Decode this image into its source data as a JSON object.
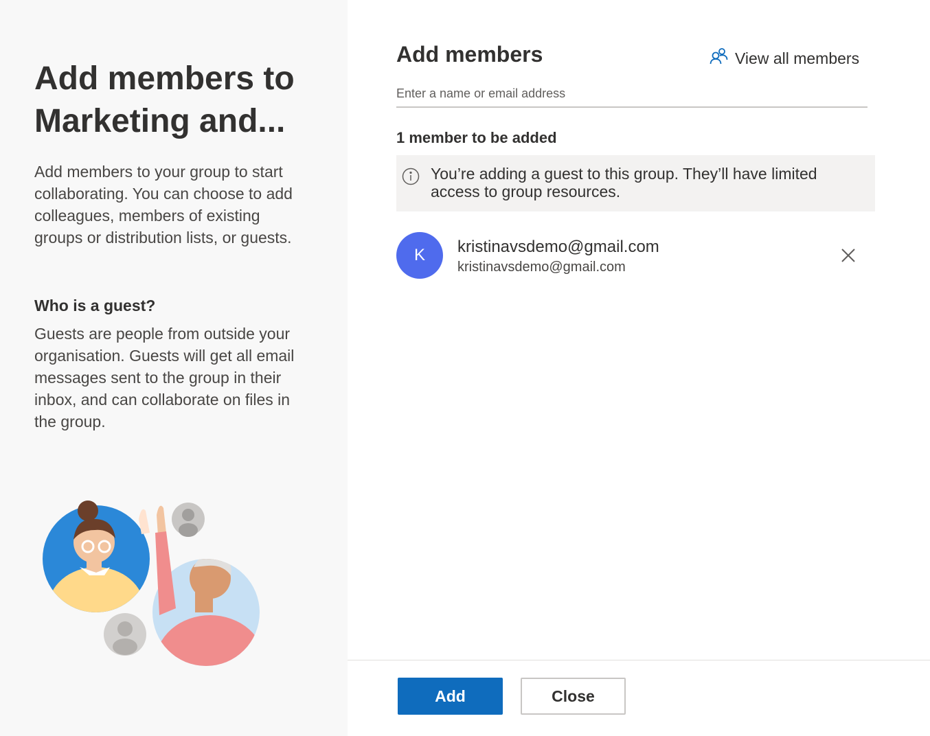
{
  "left": {
    "title": "Add members to Marketing and...",
    "description": "Add members to your group to start collaborating. You can choose to add colleagues, members of existing groups or distribution lists, or guests.",
    "guest_heading": "Who is a guest?",
    "guest_text": "Guests are people from outside your organisation. Guests will get all email messages sent to the group in their inbox, and can collaborate on files in the group."
  },
  "right": {
    "title": "Add members",
    "view_all_label": "View all members",
    "search_placeholder": "Enter a name or email address",
    "search_value": "",
    "count_text": "1 member to be added",
    "notice_text": "You’re adding a guest to this group. They’ll have limited access to group resources.",
    "members": [
      {
        "initial": "K",
        "name": "kristinavsdemo@gmail.com",
        "email": "kristinavsdemo@gmail.com",
        "avatar_color": "#4f6bed"
      }
    ]
  },
  "footer": {
    "add_label": "Add",
    "close_label": "Close"
  },
  "colors": {
    "accent": "#0f6cbd",
    "left_panel_bg": "#f8f8f8",
    "notice_bg": "#f3f2f1"
  },
  "icons": {
    "view_all": "people-icon",
    "notice": "info-icon",
    "remove": "close-icon"
  }
}
